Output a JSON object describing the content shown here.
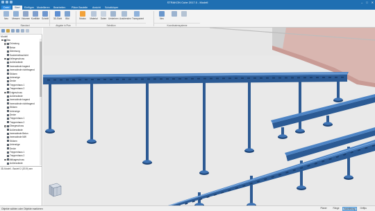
{
  "window": {
    "title": "STRAKON Cube 2017.0 - Modell",
    "min": "–",
    "max": "□",
    "close": "✕"
  },
  "tabs": [
    {
      "label": "Datei"
    },
    {
      "label": "Start"
    },
    {
      "label": "Einfügen"
    },
    {
      "label": "Modellieren"
    },
    {
      "label": "Bearbeiten"
    },
    {
      "label": "Pläne Bauteile"
    },
    {
      "label": "Ansicht"
    },
    {
      "label": "Schalkörper"
    }
  ],
  "ribbon": {
    "buttons": [
      {
        "label": "Neu",
        "icon": "new-model-icon",
        "color": "#9bb7d8"
      },
      {
        "label": "Messen",
        "icon": "measure-icon",
        "color": "#8fb0d6"
      },
      {
        "label": "Volumen",
        "icon": "volume-icon",
        "color": "#8fa6c9"
      },
      {
        "label": "Konflikte",
        "icon": "collision-icon",
        "color": "#7f9fce"
      },
      {
        "label": "Schnitt",
        "icon": "section-icon",
        "color": "#6f97cf"
      },
      {
        "label": "3D-Sicht",
        "icon": "3d-view-icon",
        "color": "#5e8fd2"
      },
      {
        "label": "Bild",
        "icon": "image-icon",
        "color": "#7ea3d0"
      },
      {
        "label": "Modus",
        "icon": "mode-icon",
        "color": "#f2a23a"
      },
      {
        "label": "Material",
        "icon": "material-icon",
        "color": "#b7c6d9"
      },
      {
        "label": "Daten",
        "icon": "data-icon",
        "color": "#c8d3e0"
      },
      {
        "label": "Umkehren",
        "icon": "invert-icon",
        "color": "#9fb5cf"
      },
      {
        "label": "Ausblenden",
        "icon": "hide-icon",
        "color": "#a9bdd4"
      },
      {
        "label": "Transparent",
        "icon": "transparent-icon",
        "color": "#8fb2db"
      },
      {
        "label": "Neu",
        "icon": "new-coordinate-icon",
        "color": "#6a97cc"
      },
      {
        "label": "",
        "icon": "coordinate-edit-icon",
        "color": "#9cb3cf"
      },
      {
        "label": "",
        "icon": "coordinate-delete-icon",
        "color": "#b5c3d3"
      }
    ],
    "groups": [
      {
        "label": "Standard"
      },
      {
        "label": "Abgabe in Plan"
      },
      {
        "label": "Selektion"
      },
      {
        "label": "Koordinatensysteme"
      }
    ]
  },
  "left_panel": {
    "header": "Modell",
    "tree": [
      {
        "label": "Bau",
        "level": 0,
        "checked": true
      },
      {
        "label": "Gründung",
        "level": 1,
        "checked": true
      },
      {
        "label": "Beton",
        "level": 2,
        "checked": true
      },
      {
        "label": "Dämmung",
        "level": 2,
        "checked": true
      },
      {
        "label": "Sauberkeitsschicht",
        "level": 2,
        "checked": true
      },
      {
        "label": "Kellergeschoss",
        "level": 1,
        "checked": true
      },
      {
        "label": "Außenwände",
        "level": 2,
        "checked": true
      },
      {
        "label": "Innenwände tragend",
        "level": 2,
        "checked": true
      },
      {
        "label": "Innenwände nichttragend",
        "level": 2,
        "checked": true
      },
      {
        "label": "Stützen",
        "level": 2,
        "checked": true
      },
      {
        "label": "Unterzüge",
        "level": 2,
        "checked": true
      },
      {
        "label": "Decke",
        "level": 2,
        "checked": true
      },
      {
        "label": "Treppenhaus 1",
        "level": 2,
        "checked": true
      },
      {
        "label": "Treppenhaus 2",
        "level": 2,
        "checked": true
      },
      {
        "label": "Erdgeschoss",
        "level": 1,
        "checked": true
      },
      {
        "label": "Außenwände",
        "level": 2,
        "checked": true
      },
      {
        "label": "Innenwände tragend",
        "level": 2,
        "checked": true
      },
      {
        "label": "Innenwände nichttragend",
        "level": 2,
        "checked": true
      },
      {
        "label": "Stützen",
        "level": 2,
        "checked": true
      },
      {
        "label": "Unterzüge",
        "level": 2,
        "checked": true
      },
      {
        "label": "Decke",
        "level": 2,
        "checked": true
      },
      {
        "label": "Treppenhaus 1",
        "level": 2,
        "checked": true
      },
      {
        "label": "Treppenhaus 2",
        "level": 2,
        "checked": true
      },
      {
        "label": "Obergeschoss",
        "level": 1,
        "checked": true
      },
      {
        "label": "Außenwände",
        "level": 2,
        "checked": true
      },
      {
        "label": "Innenwände Beton",
        "level": 2,
        "checked": true
      },
      {
        "label": "Innenwände MW",
        "level": 2,
        "checked": true
      },
      {
        "label": "Stützen",
        "level": 2,
        "checked": true
      },
      {
        "label": "Unterzüge",
        "level": 2,
        "checked": true
      },
      {
        "label": "Decke",
        "level": 2,
        "checked": true
      },
      {
        "label": "Treppenhaus 1",
        "level": 2,
        "checked": true
      },
      {
        "label": "Treppenhaus 2",
        "level": 2,
        "checked": true
      },
      {
        "label": "Attikageschoss",
        "level": 1,
        "checked": true
      },
      {
        "label": "Außenwände",
        "level": 2,
        "checked": true
      }
    ],
    "info": "3D-Modell - Bauteil 2 (2019) ann"
  },
  "status": {
    "message": "Objekte wählen oder Objekte markieren",
    "buttons": [
      {
        "label": "Planer",
        "active": false
      },
      {
        "label": "Fänge",
        "active": false
      },
      {
        "label": "Aufzählung",
        "active": true
      },
      {
        "label": "Griffpu",
        "active": false
      }
    ]
  },
  "colors": {
    "accent": "#1f6fb2",
    "rail": "#3c6fb0",
    "post": "#2d5a93",
    "wall": "#d6b2ac"
  }
}
